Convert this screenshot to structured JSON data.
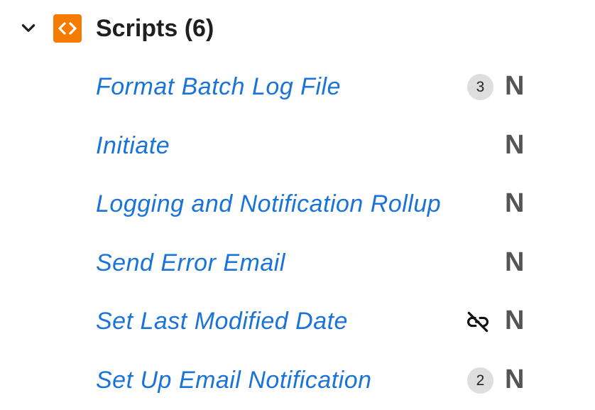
{
  "group": {
    "title": "Scripts (6)",
    "icon": "code-brackets-icon",
    "icon_color": "#f57c00",
    "expanded": true
  },
  "colors": {
    "link": "#1a73d9",
    "badge_bg": "#dedede",
    "status": "#555555"
  },
  "items": [
    {
      "label": "Format Batch Log File",
      "count": "3",
      "status": "N"
    },
    {
      "label": "Initiate",
      "status": "N"
    },
    {
      "label": "Logging and Notification Rollup",
      "status": "N"
    },
    {
      "label": "Send Error Email",
      "status": "N"
    },
    {
      "label": "Set Last Modified Date",
      "icon": "link-off-icon",
      "status": "N"
    },
    {
      "label": "Set Up Email Notification",
      "count": "2",
      "status": "N"
    }
  ]
}
